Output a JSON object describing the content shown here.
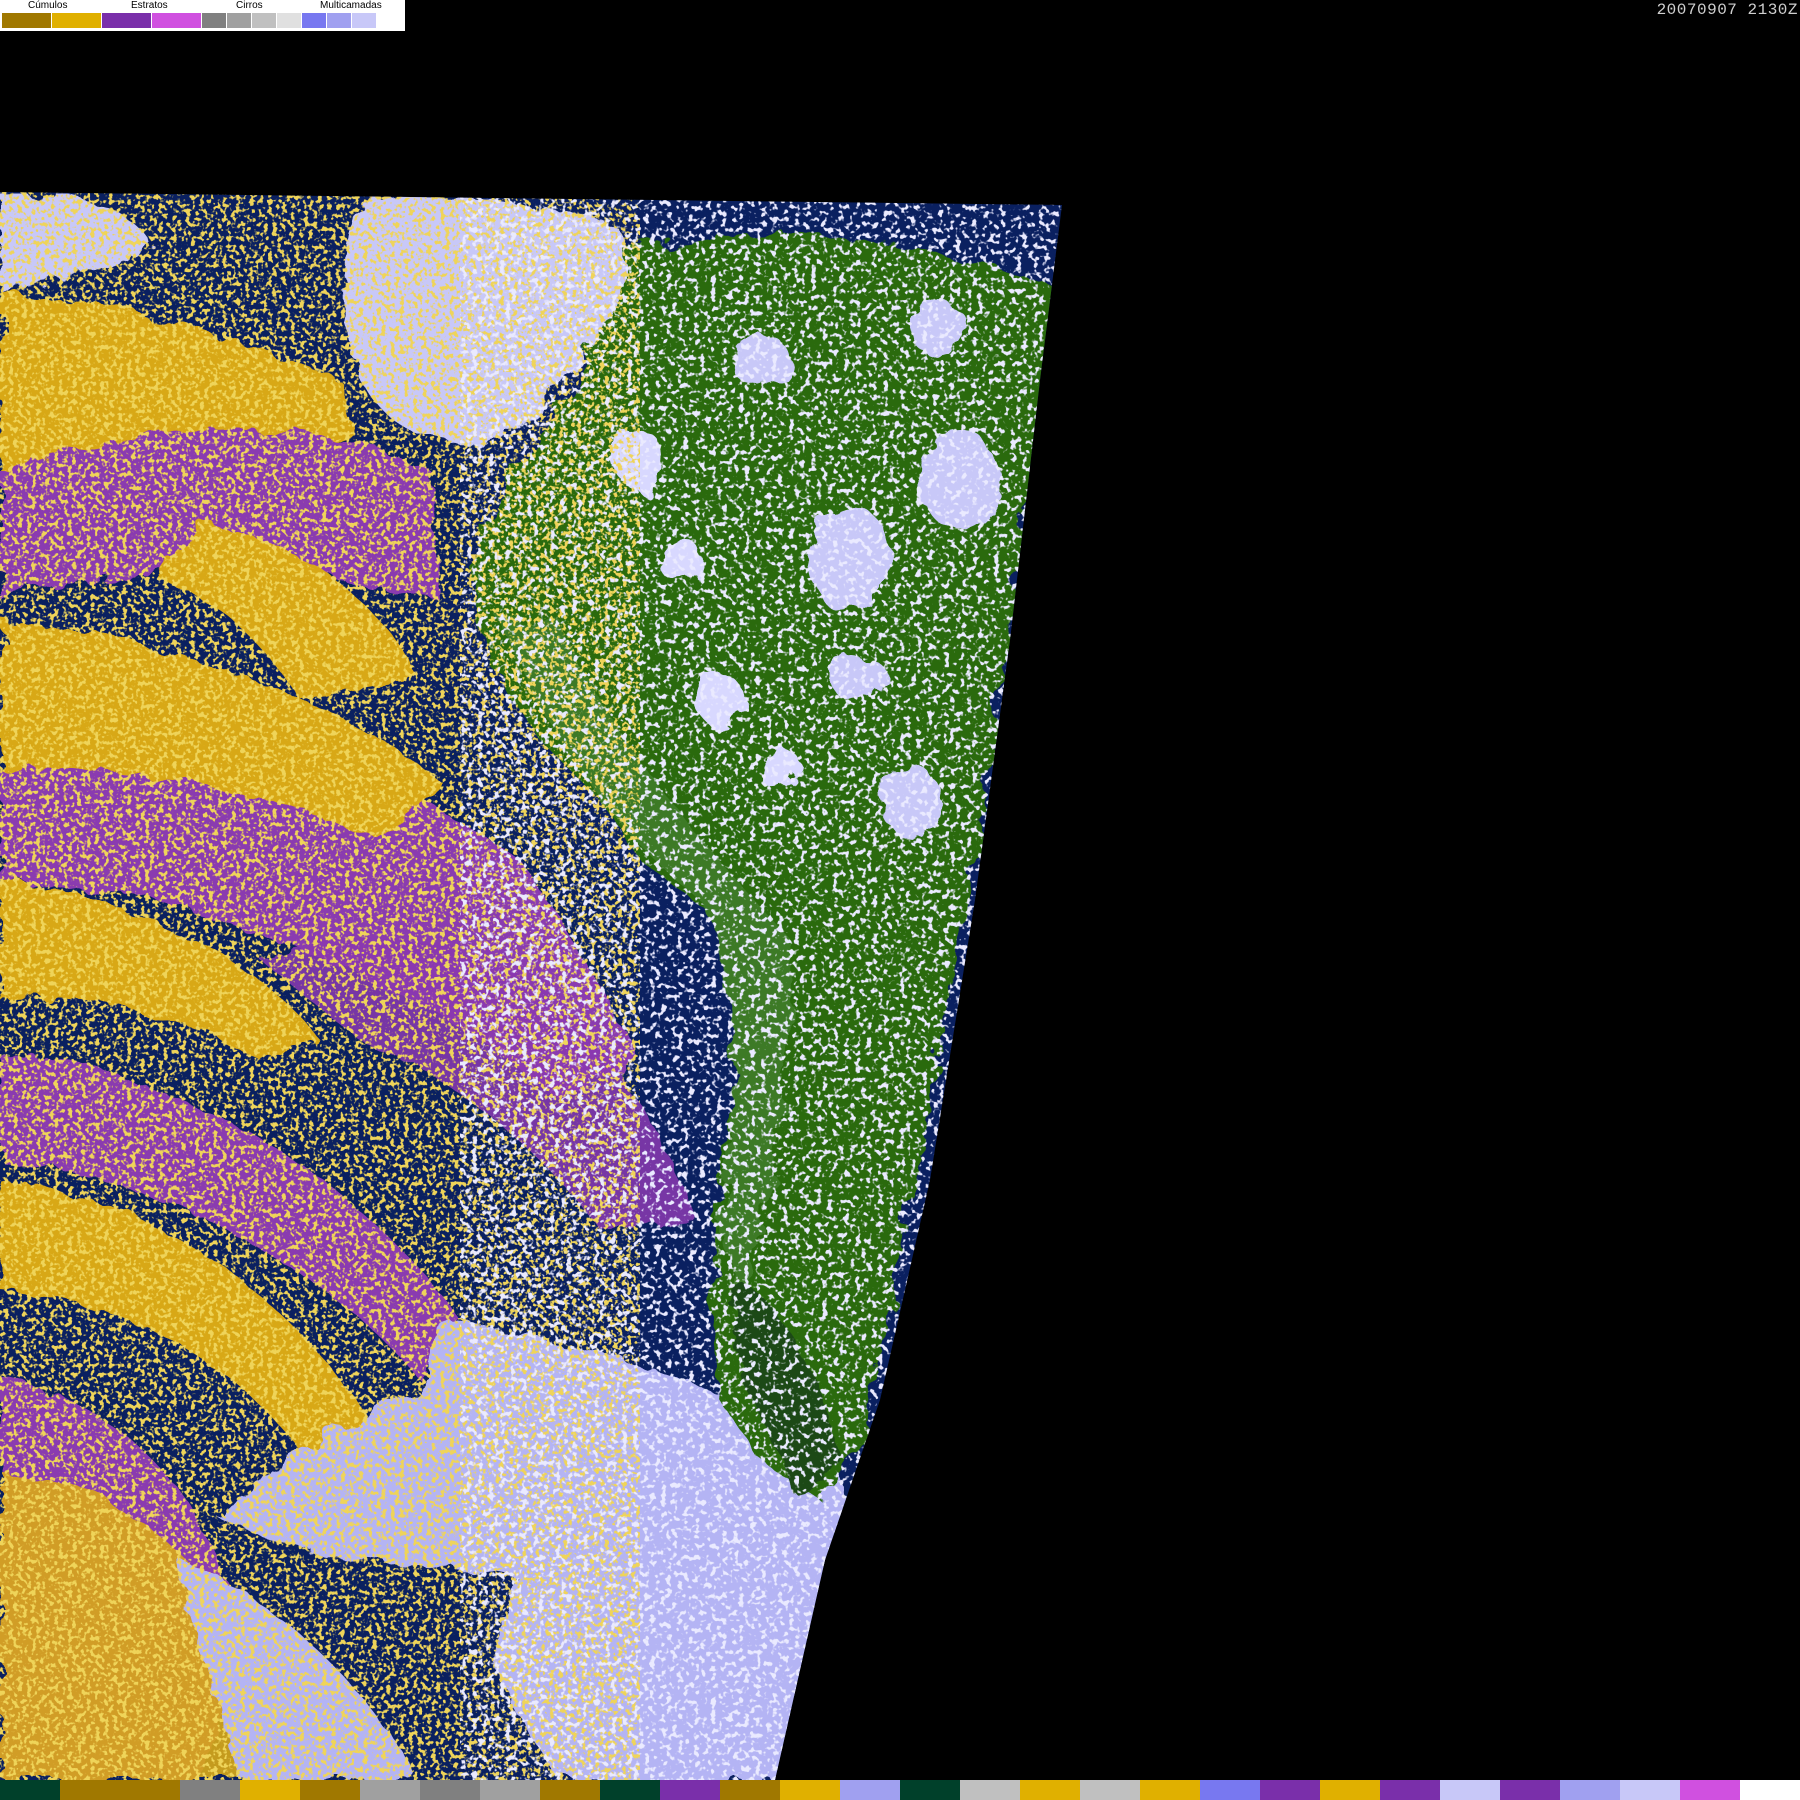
{
  "legend": {
    "categories": [
      {
        "label": "Cúmulos",
        "colors": [
          "#a07800",
          "#e0b000"
        ]
      },
      {
        "label": "Estratos",
        "colors": [
          "#7a2faa",
          "#d050e0"
        ]
      },
      {
        "label": "Cirros",
        "colors": [
          "#808080",
          "#a0a0a0",
          "#c0c0c0",
          "#e0e0e0"
        ]
      },
      {
        "label": "Multicamadas",
        "colors": [
          "#7878f0",
          "#a0a0f0",
          "#c8c8f8",
          "#ffffff"
        ]
      }
    ]
  },
  "timestamp": "20070907 2130Z",
  "colors": {
    "background": "#000000",
    "ocean": "#0a2060",
    "land_green": "#2a6a10",
    "land_dark": "#1e4a14",
    "cumulus": "#d8a818",
    "stratus": "#8a3ab0",
    "cirrus": "#b0b0b0",
    "multilayer": "#b4b4f4",
    "multilayer_light": "#e0e0ff"
  },
  "bottom_strip": [
    "#00402a",
    "#a07800",
    "#a07800",
    "#808080",
    "#e0b000",
    "#a07800",
    "#a0a0a0",
    "#808080",
    "#a0a0a0",
    "#a07800",
    "#00402a",
    "#7a2faa",
    "#a07800",
    "#e0b000",
    "#a0a0f0",
    "#00402a",
    "#c0c0c0",
    "#e0b000",
    "#c0c0c0",
    "#e0b000",
    "#7878f0",
    "#7a2faa",
    "#e0b000",
    "#7a2faa",
    "#c8c8f8",
    "#7a2faa",
    "#a0a0f0",
    "#c8c8f8",
    "#d050e0",
    "#ffffff"
  ]
}
